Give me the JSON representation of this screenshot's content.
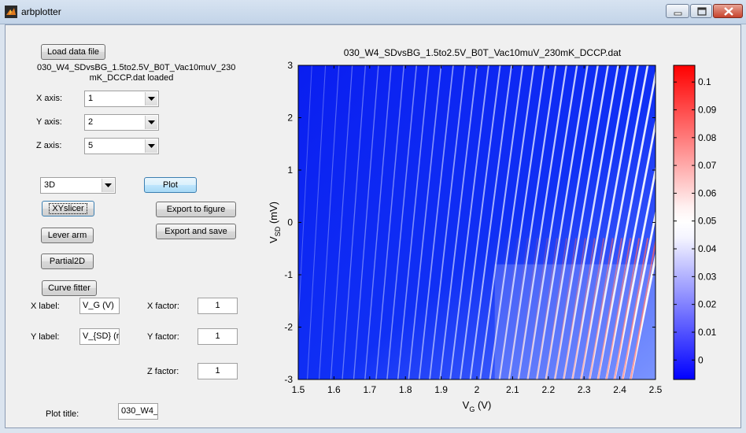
{
  "window": {
    "title": "arbplotter"
  },
  "left_panel": {
    "load_button": "Load data file",
    "loaded_file_line1": "030_W4_SDvsBG_1.5to2.5V_B0T_Vac10muV_230",
    "loaded_file_line2": "mK_DCCP.dat loaded",
    "x_axis_label": "X axis:",
    "x_axis_value": "1",
    "y_axis_label": "Y axis:",
    "y_axis_value": "2",
    "z_axis_label": "Z axis:",
    "z_axis_value": "5",
    "mode_value": "3D",
    "plot_button": "Plot",
    "xyslicer_button": "XYslicer",
    "export_figure_button": "Export to figure",
    "export_save_button": "Export and save",
    "lever_arm_button": "Lever arm",
    "partial2d_button": "Partial2D",
    "curve_fitter_button": "Curve fitter",
    "x_label_label": "X label:",
    "x_label_value": "V_G (V)",
    "y_label_label": "Y label:",
    "y_label_value": "V_{SD} (r",
    "x_factor_label": "X factor:",
    "x_factor_value": "1",
    "y_factor_label": "Y factor:",
    "y_factor_value": "1",
    "z_factor_label": "Z factor:",
    "z_factor_value": "1",
    "plot_title_label": "Plot title:",
    "plot_title_value": "030_W4_"
  },
  "colors": {
    "low": "#0000ff",
    "mid": "#ffffff",
    "high": "#ff0000",
    "window_bg": "#f0f0f0"
  },
  "chart_data": {
    "type": "heatmap",
    "title": "030_W4_SDvsBG_1.5to2.5V_B0T_Vac10muV_230mK_DCCP.dat",
    "xlabel": "V_G (V)",
    "ylabel": "V_SD (mV)",
    "xlim": [
      1.5,
      2.5
    ],
    "ylim": [
      -3,
      3
    ],
    "x_ticks": [
      "1.5",
      "1.6",
      "1.7",
      "1.8",
      "1.9",
      "2",
      "2.1",
      "2.2",
      "2.3",
      "2.4",
      "2.5"
    ],
    "y_ticks": [
      "-3",
      "-2",
      "-1",
      "0",
      "1",
      "2",
      "3"
    ],
    "colorbar": {
      "range": [
        -0.007,
        0.106
      ],
      "ticks": [
        "0",
        "0.01",
        "0.02",
        "0.03",
        "0.04",
        "0.05",
        "0.06",
        "0.07",
        "0.08",
        "0.09",
        "0.1"
      ]
    }
  }
}
